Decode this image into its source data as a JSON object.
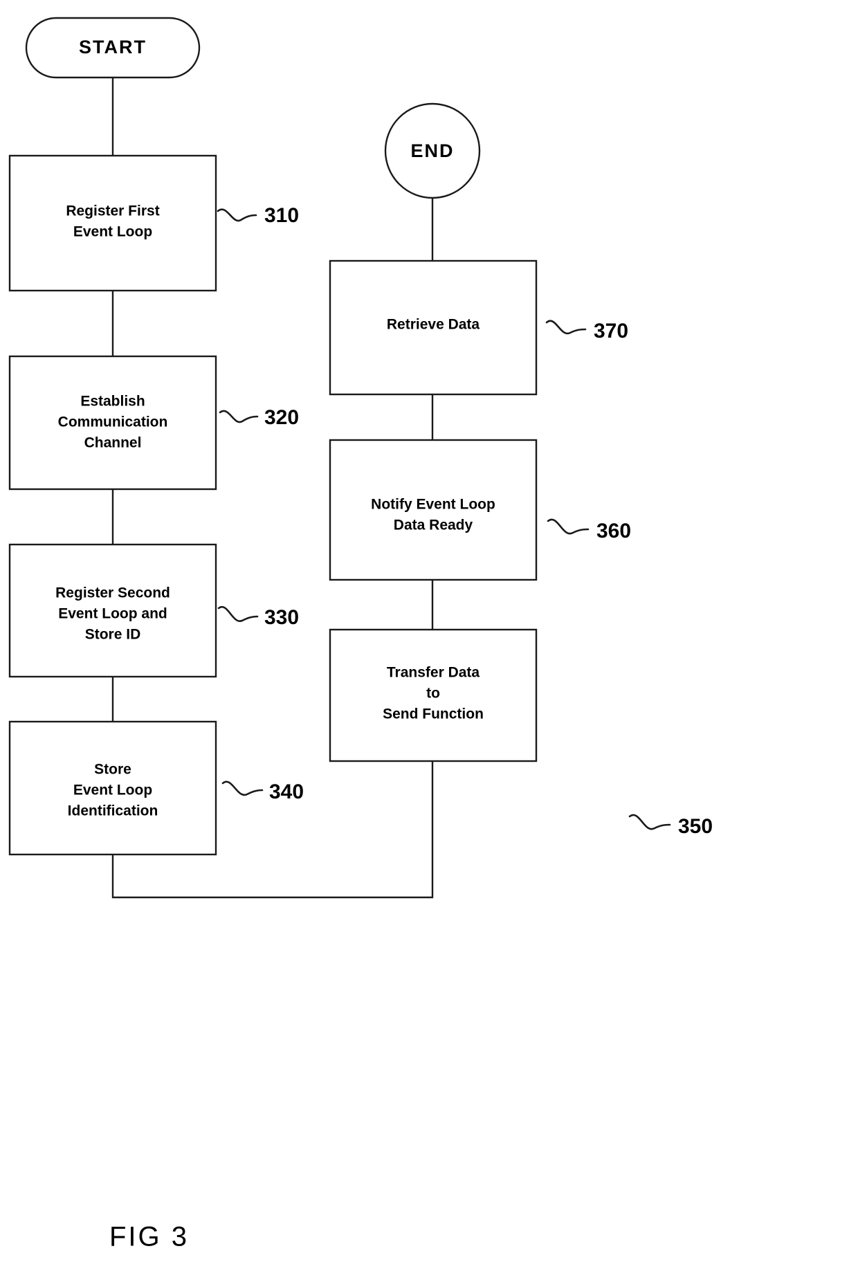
{
  "figure": {
    "caption": "FIG 3",
    "title": "FIG 3"
  },
  "diagram": {
    "type": "flowchart",
    "orientation": "two-column, left column top-to-bottom then right column bottom-to-top",
    "terminals": [
      {
        "id": "start",
        "label": "START",
        "shape": "stadium"
      },
      {
        "id": "end",
        "label": "END",
        "shape": "circle"
      }
    ],
    "nodes": [
      {
        "id": "n310",
        "ref": "310",
        "shape": "rectangle",
        "lines": [
          "Register First",
          "Event Loop"
        ],
        "text": "Register First Event Loop"
      },
      {
        "id": "n320",
        "ref": "320",
        "shape": "rectangle",
        "lines": [
          "Establish",
          "Communication",
          "Channel"
        ],
        "text": "Establish Communication Channel"
      },
      {
        "id": "n330",
        "ref": "330",
        "shape": "rectangle",
        "lines": [
          "Register Second",
          "Event Loop and",
          "Store ID"
        ],
        "text": "Register Second Event Loop and Store ID"
      },
      {
        "id": "n340",
        "ref": "340",
        "shape": "rectangle",
        "lines": [
          "Store",
          "Event Loop",
          "Identification"
        ],
        "text": "Store Event Loop Identification"
      },
      {
        "id": "n350",
        "ref": "350",
        "shape": "rectangle",
        "lines": [
          "Transfer Data",
          "to",
          "Send Function"
        ],
        "text": "Transfer Data to Send Function"
      },
      {
        "id": "n360",
        "ref": "360",
        "shape": "rectangle",
        "lines": [
          "Notify Event Loop",
          "Data Ready"
        ],
        "text": "Notify Event Loop Data Ready"
      },
      {
        "id": "n370",
        "ref": "370",
        "shape": "rectangle",
        "lines": [
          "Retrieve Data"
        ],
        "text": "Retrieve Data"
      }
    ],
    "edges": [
      {
        "from": "start",
        "to": "n310"
      },
      {
        "from": "n310",
        "to": "n320"
      },
      {
        "from": "n320",
        "to": "n330"
      },
      {
        "from": "n330",
        "to": "n340"
      },
      {
        "from": "n340",
        "to": "n350"
      },
      {
        "from": "n350",
        "to": "n360"
      },
      {
        "from": "n360",
        "to": "n370"
      },
      {
        "from": "n370",
        "to": "end"
      }
    ],
    "colors": {
      "background": "#ffffff",
      "stroke": "#1a1a1a",
      "text": "#000000"
    }
  }
}
